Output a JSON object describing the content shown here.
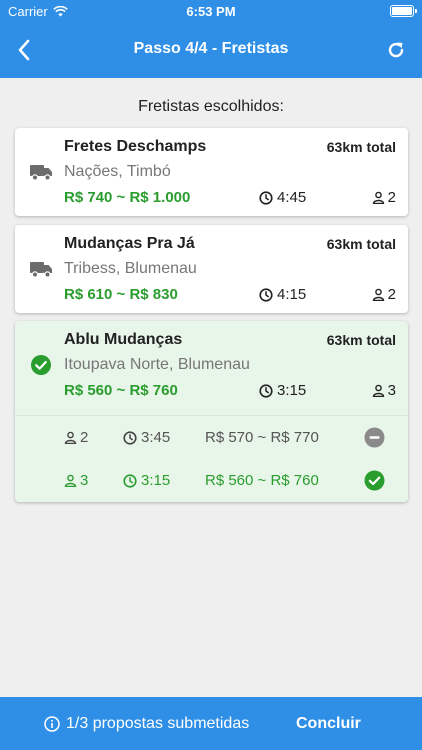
{
  "status_bar": {
    "carrier": "Carrier",
    "time": "6:53 PM"
  },
  "header": {
    "title": "Passo 4/4 - Fretistas",
    "back_icon": "chevron-left-icon",
    "refresh_icon": "refresh-icon"
  },
  "section": {
    "title": "Fretistas escolhidos:"
  },
  "movers": [
    {
      "name": "Fretes Deschamps",
      "distance": "63km total",
      "location": "Nações, Timbó",
      "price": "R$ 740 ~ R$ 1.000",
      "duration": "4:45",
      "people": "2"
    },
    {
      "name": "Mudanças Pra Já",
      "distance": "63km total",
      "location": "Tribess, Blumenau",
      "price": "R$ 610 ~ R$ 830",
      "duration": "4:15",
      "people": "2"
    },
    {
      "name": "Ablu Mudanças",
      "distance": "63km total",
      "location": "Itoupava Norte, Blumenau",
      "price": "R$ 560 ~ R$ 760",
      "duration": "3:15",
      "people": "3"
    }
  ],
  "options": [
    {
      "people": "2",
      "duration": "3:45",
      "price": "R$ 570 ~ R$ 770",
      "status": "unselected"
    },
    {
      "people": "3",
      "duration": "3:15",
      "price": "R$ 560 ~ R$ 760",
      "status": "selected"
    }
  ],
  "footer": {
    "info": "1/3 propostas submetidas",
    "conclude_label": "Concluir"
  },
  "colors": {
    "primary": "#2f8fe6",
    "success": "#2a9d2f",
    "selected_bg": "#e8f5e9",
    "muted_icon": "#8a8a8a"
  }
}
